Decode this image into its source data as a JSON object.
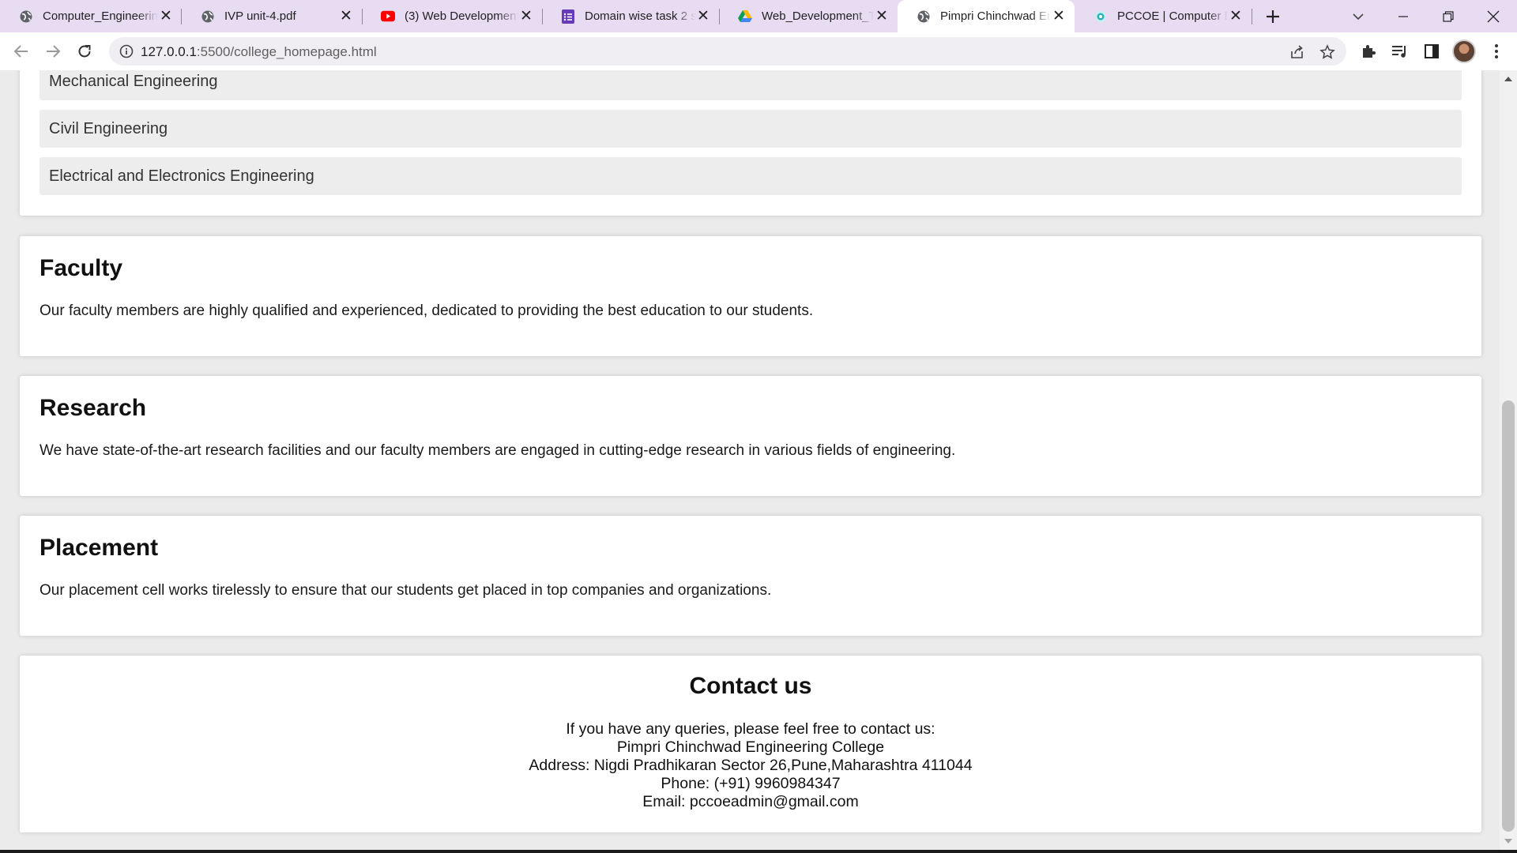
{
  "browser": {
    "tabs": [
      {
        "title": "Computer_Engineering",
        "icon": "globe-icon",
        "active": false
      },
      {
        "title": "IVP unit-4.pdf",
        "icon": "globe-icon",
        "active": false
      },
      {
        "title": "(3) Web Development",
        "icon": "youtube-icon",
        "active": false
      },
      {
        "title": "Domain wise task 2 su",
        "icon": "forms-icon",
        "active": false
      },
      {
        "title": "Web_Development_Ta",
        "icon": "drive-icon",
        "active": false
      },
      {
        "title": "Pimpri Chinchwad Eng",
        "icon": "globe-icon",
        "active": true
      },
      {
        "title": "PCCOE | Computer En",
        "icon": "pccoe-icon",
        "active": false
      }
    ],
    "url": {
      "host": "127.0.0.1",
      "path": ":5500/college_homepage.html"
    }
  },
  "page": {
    "departments": [
      "Mechanical Engineering",
      "Civil Engineering",
      "Electrical and Electronics Engineering"
    ],
    "faculty": {
      "title": "Faculty",
      "text": "Our faculty members are highly qualified and experienced, dedicated to providing the best education to our students."
    },
    "research": {
      "title": "Research",
      "text": "We have state-of-the-art research facilities and our faculty members are engaged in cutting-edge research in various fields of engineering."
    },
    "placement": {
      "title": "Placement",
      "text": "Our placement cell works tirelessly to ensure that our students get placed in top companies and organizations."
    },
    "contact": {
      "title": "Contact us",
      "intro": "If you have any queries, please feel free to contact us:",
      "college": "Pimpri Chinchwad Engineering College",
      "address": "Address: Nigdi Pradhikaran Sector 26,Pune,Maharashtra 411044",
      "phone": "Phone: (+91) 9960984347",
      "email": "Email: pccoeadmin@gmail.com"
    }
  },
  "colors": {
    "tabstrip": "#e8dcf3",
    "page_bg": "#ebebeb",
    "card_bg": "#ffffff",
    "dept_bg": "#ededed"
  }
}
